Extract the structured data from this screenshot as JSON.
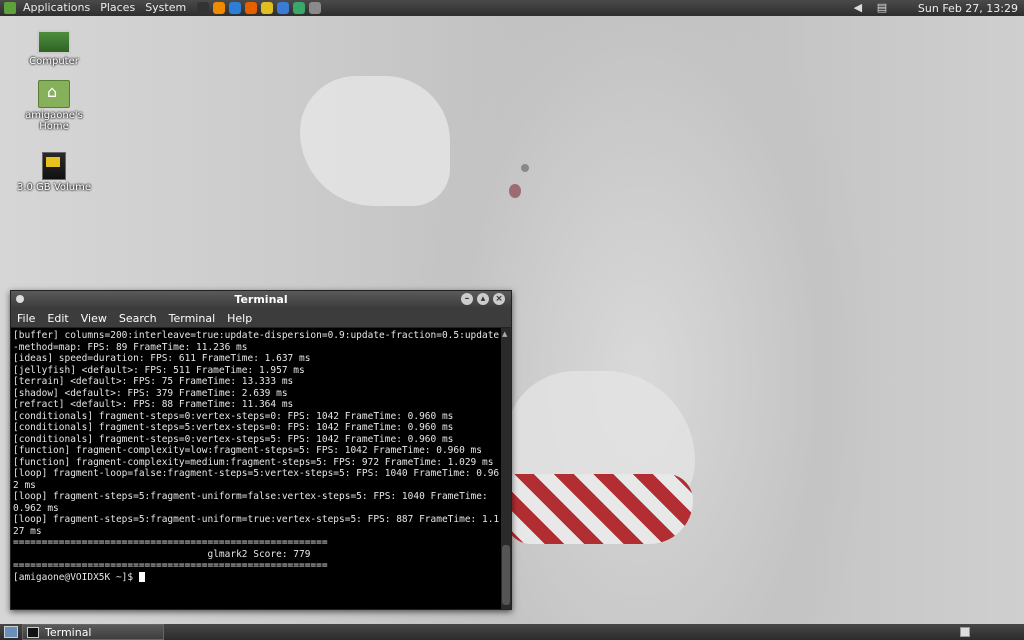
{
  "top_panel": {
    "menus": [
      "Applications",
      "Places",
      "System"
    ],
    "launchers": [
      {
        "name": "terminal-launcher",
        "color": "#333333"
      },
      {
        "name": "vlc-launcher",
        "color": "#f08a00"
      },
      {
        "name": "browser-launcher",
        "color": "#2c7fd6"
      },
      {
        "name": "firefox-launcher",
        "color": "#e66000"
      },
      {
        "name": "emblem-launcher",
        "color": "#e0c020"
      },
      {
        "name": "network-launcher",
        "color": "#3a7bd5"
      },
      {
        "name": "chat-launcher",
        "color": "#3aa86a"
      },
      {
        "name": "image-launcher",
        "color": "#8a8a8a"
      }
    ],
    "clock": "Sun Feb 27, 13:29"
  },
  "desktop_icons": [
    {
      "label": "Computer",
      "icon": "computer-icon"
    },
    {
      "label": "amigaone's Home",
      "icon": "home-folder-icon"
    },
    {
      "label": "3.0 GB Volume",
      "icon": "drive-icon"
    }
  ],
  "terminal": {
    "title": "Terminal",
    "menus": [
      "File",
      "Edit",
      "View",
      "Search",
      "Terminal",
      "Help"
    ],
    "lines": [
      "[buffer] columns=200:interleave=true:update-dispersion=0.9:update-fraction=0.5:update-method=map: FPS: 89 FrameTime: 11.236 ms",
      "[ideas] speed=duration: FPS: 611 FrameTime: 1.637 ms",
      "[jellyfish] <default>: FPS: 511 FrameTime: 1.957 ms",
      "[terrain] <default>: FPS: 75 FrameTime: 13.333 ms",
      "[shadow] <default>: FPS: 379 FrameTime: 2.639 ms",
      "[refract] <default>: FPS: 88 FrameTime: 11.364 ms",
      "[conditionals] fragment-steps=0:vertex-steps=0: FPS: 1042 FrameTime: 0.960 ms",
      "[conditionals] fragment-steps=5:vertex-steps=0: FPS: 1042 FrameTime: 0.960 ms",
      "[conditionals] fragment-steps=0:vertex-steps=5: FPS: 1042 FrameTime: 0.960 ms",
      "[function] fragment-complexity=low:fragment-steps=5: FPS: 1042 FrameTime: 0.960 ms",
      "[function] fragment-complexity=medium:fragment-steps=5: FPS: 972 FrameTime: 1.029 ms",
      "[loop] fragment-loop=false:fragment-steps=5:vertex-steps=5: FPS: 1040 FrameTime: 0.962 ms",
      "[loop] fragment-steps=5:fragment-uniform=false:vertex-steps=5: FPS: 1040 FrameTime: 0.962 ms",
      "[loop] fragment-steps=5:fragment-uniform=true:vertex-steps=5: FPS: 887 FrameTime: 1.127 ms",
      "=======================================================",
      "                                  glmark2 Score: 779",
      "======================================================="
    ],
    "prompt": "[amigaone@VOIDX5K ~]$ "
  },
  "bottom_panel": {
    "task_label": "Terminal"
  }
}
